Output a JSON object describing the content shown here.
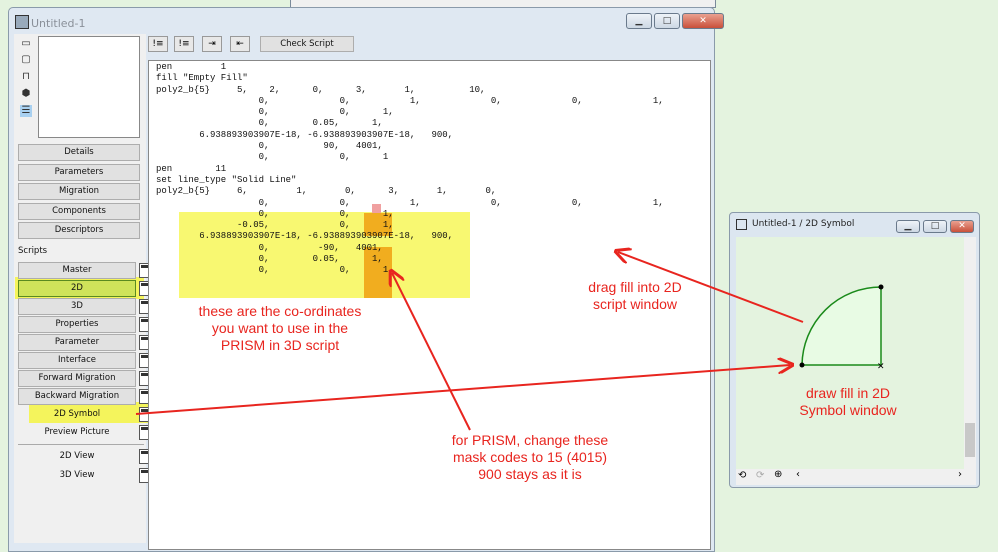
{
  "window": {
    "title": "Untitled-1"
  },
  "toolbar": {
    "check_script": "Check Script"
  },
  "sections": [
    "Details",
    "Parameters",
    "Migration",
    "Components",
    "Descriptors"
  ],
  "scripts_label": "Scripts",
  "scripts": [
    "Master",
    "2D",
    "3D",
    "Properties",
    "Parameter",
    "Interface",
    "Forward Migration",
    "Backward Migration",
    "2D Symbol",
    "Preview Picture"
  ],
  "views": [
    "2D View",
    "3D View"
  ],
  "code_lines": [
    "pen         1",
    "fill \"Empty Fill\"",
    "poly2_b{5}     5,    2,      0,      3,       1,          10,",
    "                   0,             0,           1,             0,             0,             1,",
    "                   0,             0,      1,",
    "                   0,        0.05,      1,",
    "        6.938893903907E-18, -6.938893903907E-18,   900,",
    "                   0,          90,   4001,",
    "                   0,             0,      1",
    "pen        11",
    "set line_type \"Solid Line\"",
    "poly2_b{5}     6,         1,       0,      3,       1,       0,",
    "                   0,             0,           1,             0,             0,             1,",
    "                   0,             0,      1,",
    "               -0.05,             0,      1,",
    "        6.938893903907E-18, -6.938893903907E-18,   900,",
    "                   0,         -90,   4001,",
    "                   0,        0.05,      1,",
    "                   0,             0,      1"
  ],
  "annotations": {
    "coords": "these are the co-ordinates\nyou want to use in the\nPRISM in 3D script",
    "mask": "for PRISM, change these\nmask codes to 15 (4015)\n900 stays as it is",
    "drag": "drag fill into 2D\nscript window",
    "draw": "draw fill in 2D\nSymbol window"
  },
  "symbol_window": {
    "title": "Untitled-1 / 2D Symbol"
  },
  "colors": {
    "highlight": "#f5f542",
    "orange": "#f0a010",
    "annotation": "#e8251f",
    "shape": "#1a8a1a"
  }
}
